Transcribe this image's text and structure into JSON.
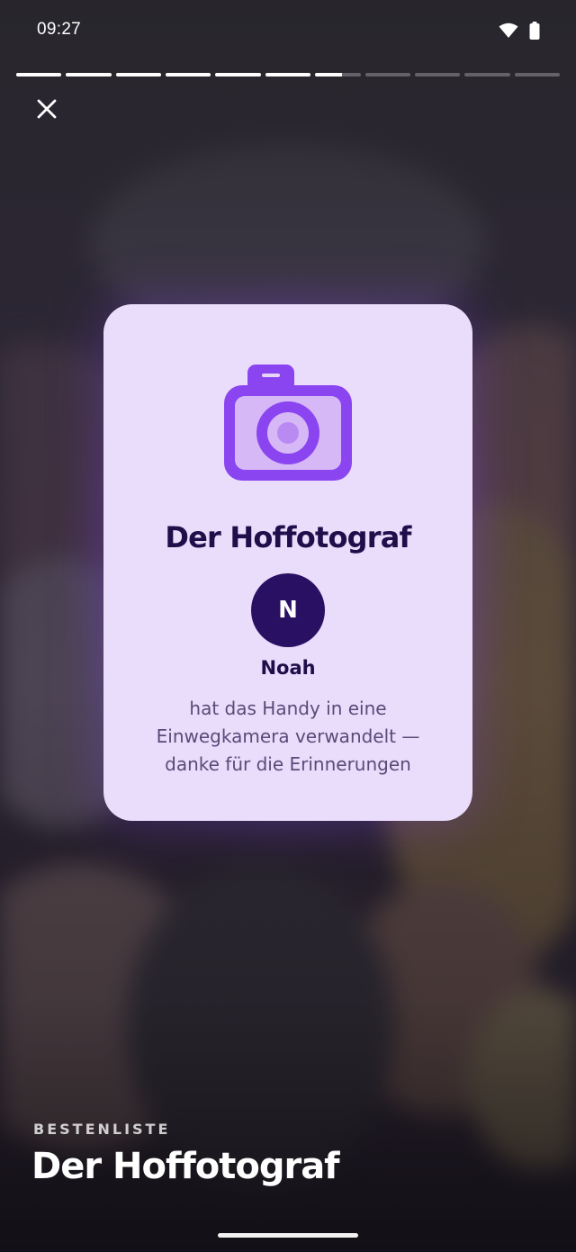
{
  "status_bar": {
    "time": "09:27",
    "wifi_icon": "wifi-icon",
    "battery_icon": "battery-icon"
  },
  "story_progress": {
    "segments": [
      1,
      1,
      1,
      1,
      1,
      1,
      0.6,
      0,
      0,
      0,
      0
    ]
  },
  "close_icon": "close-icon",
  "award_card": {
    "icon": "camera-icon",
    "title": "Der Hoffotograf",
    "avatar_initial": "N",
    "name": "Noah",
    "description_lines": [
      "hat das Handy in eine",
      "Einwegkamera verwandelt —",
      "danke für die Erinnerungen"
    ]
  },
  "footer": {
    "section_label": "BESTENLISTE",
    "title": "Der Hoffotograf"
  },
  "colors": {
    "card_background": "#eadcfb",
    "accent_purple": "#8b45f0",
    "dark_text": "#1f0e4a",
    "avatar_background": "#2a1063"
  }
}
